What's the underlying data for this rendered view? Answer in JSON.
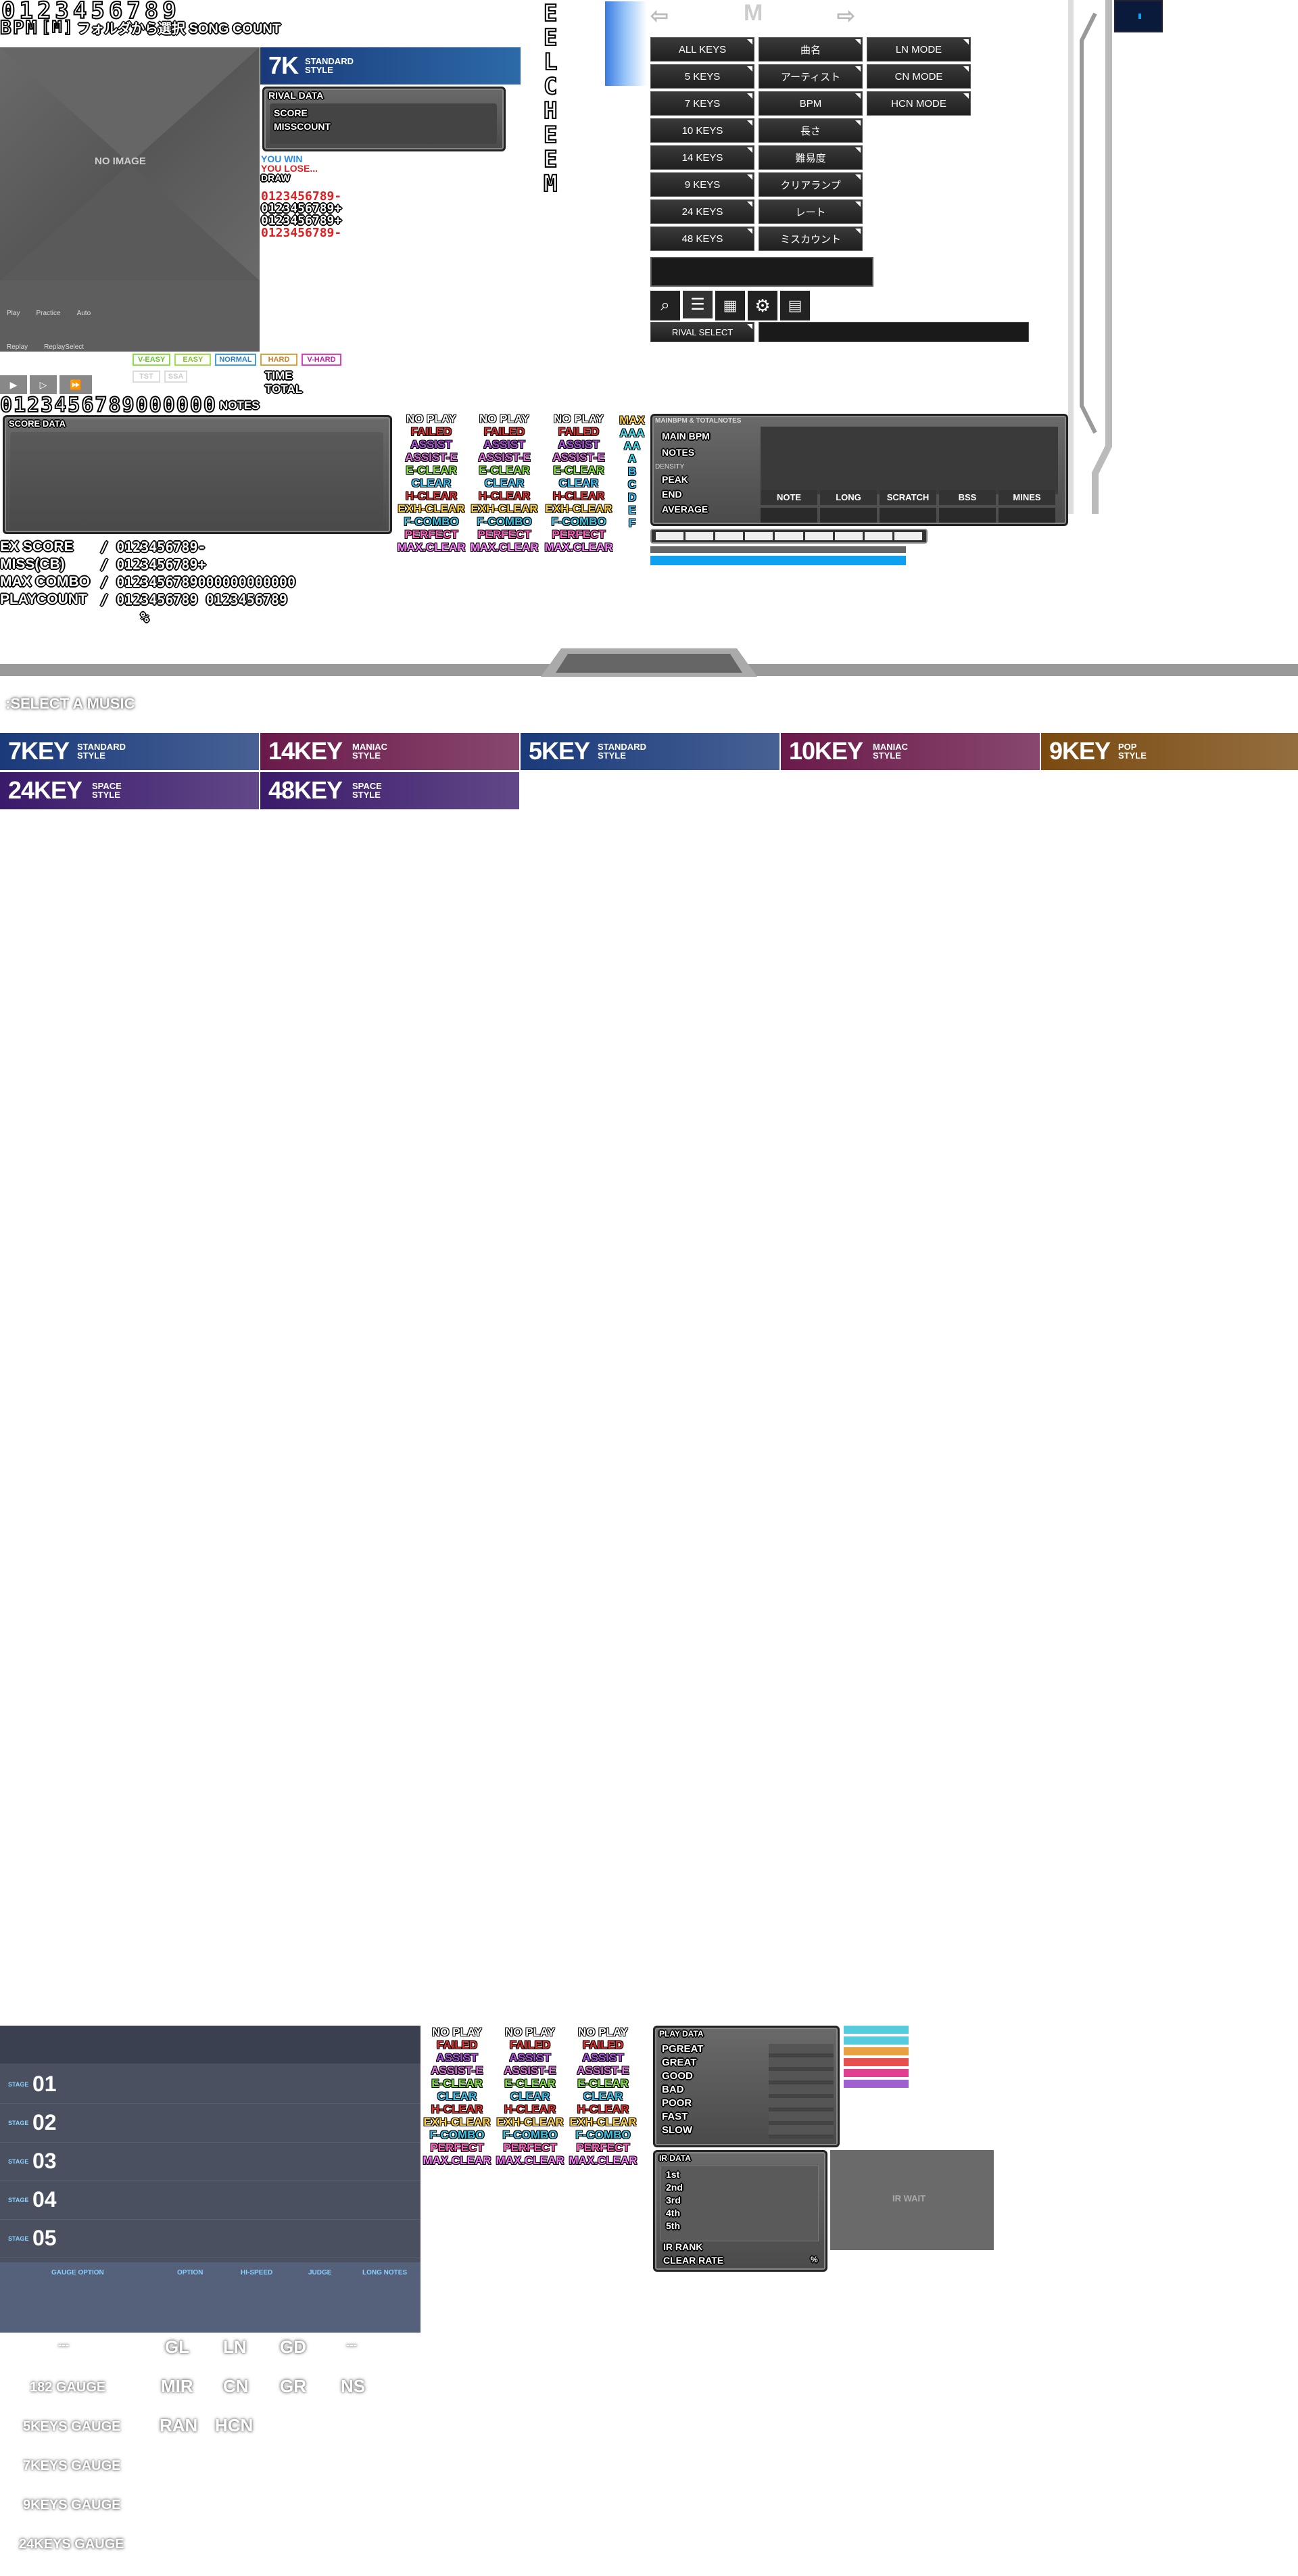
{
  "top": {
    "digits_row": "0123456789",
    "bpm_label": "BPM",
    "bpm_value": "[M]",
    "folder_line": "フォルダから選択 SONG COUNT"
  },
  "noimage": {
    "label": "NO IMAGE",
    "play": "Play",
    "practice": "Practice",
    "auto": "Auto",
    "replay": "Replay",
    "replay_select": "ReplaySelect"
  },
  "style_banner": {
    "big": "7K",
    "line1": "STANDARD",
    "line2": "STYLE"
  },
  "rival": {
    "title": "RIVAL DATA",
    "score": "SCORE",
    "misscount": "MISSCOUNT"
  },
  "result": {
    "win": "YOU WIN",
    "lose": "YOU LOSE...",
    "draw": "DRAW",
    "d1": "0123456789",
    "s1": "-",
    "d2": "0123456789",
    "s2": "+",
    "d3": "0123456789",
    "s3": "+",
    "d4": "0123456789",
    "s4": "-"
  },
  "difficulty": {
    "veasy": "V-EASY",
    "easy": "EASY",
    "normal": "NORMAL",
    "hard": "HARD",
    "vhard": "V-HARD",
    "tst": "TST",
    "ssa": "SSA"
  },
  "info_labels": {
    "time": "TIME",
    "total": "TOTAL",
    "notes": "NOTES"
  },
  "big_digits": "0123456789000000",
  "score_data_title": "SCORE DATA",
  "stats": {
    "ex_score": "EX SCORE",
    "miss": "MISS(CB)",
    "max_combo": "MAX COMBO",
    "playcount": "PLAYCOUNT",
    "v1": "0123456789",
    "v1s": "-",
    "v2": "0123456789",
    "v2s": "+",
    "v3": "0123456789",
    "v4": "000000000000",
    "v5a": "0123456789",
    "v5b": "0123456789",
    "pct": "%"
  },
  "lamps": [
    "NO PLAY",
    "FAILED",
    "ASSIST",
    "ASSIST-E",
    "E-CLEAR",
    "CLEAR",
    "H-CLEAR",
    "EXH-CLEAR",
    "F-COMBO",
    "PERFECT",
    "MAX.CLEAR"
  ],
  "ranks": [
    "MAX",
    "AAA",
    "AA",
    "A",
    "B",
    "C",
    "D",
    "E",
    "F"
  ],
  "vertical_chars": [
    "E",
    "E",
    "L",
    "C",
    "H",
    "E",
    "E",
    "M"
  ],
  "keys_menu": {
    "all": "ALL KEYS",
    "k5": "5 KEYS",
    "k7": "7 KEYS",
    "k10": "10 KEYS",
    "k14": "14 KEYS",
    "k9": "9 KEYS",
    "k24": "24 KEYS",
    "k48": "48 KEYS"
  },
  "sort_menu": {
    "title": "曲名",
    "artist": "アーティスト",
    "bpm": "BPM",
    "length": "長さ",
    "diff": "難易度",
    "clear": "クリアランプ",
    "rate": "レート",
    "miss": "ミスカウント"
  },
  "mode_menu": {
    "ln": "LN MODE",
    "cn": "CN MODE",
    "hcn": "HCN MODE"
  },
  "rival_select": "RIVAL SELECT",
  "chart_info": {
    "title": "MAINBPM & TOTALNOTES",
    "main_bpm": "MAIN BPM",
    "notes": "NOTES",
    "density": "DENSITY",
    "peak": "PEAK",
    "end": "END",
    "average": "AVERAGE",
    "note": "NOTE",
    "long": "LONG",
    "scratch": "SCRATCH",
    "bss": "BSS",
    "mines": "MINES"
  },
  "select_music": ":SELECT A MUSIC",
  "banners": [
    {
      "big": "7KEY",
      "l1": "STANDARD",
      "l2": "STYLE",
      "color": "#1a3a7a"
    },
    {
      "big": "14KEY",
      "l1": "MANIAC",
      "l2": "STYLE",
      "color": "#6a1a4a"
    },
    {
      "big": "5KEY",
      "l1": "STANDARD",
      "l2": "STYLE",
      "color": "#1a3a7a"
    },
    {
      "big": "10KEY",
      "l1": "MANIAC",
      "l2": "STYLE",
      "color": "#6a1a4a"
    },
    {
      "big": "9KEY",
      "l1": "POP",
      "l2": "STYLE",
      "color": "#7a4a10"
    },
    {
      "big": "24KEY",
      "l1": "SPACE",
      "l2": "STYLE",
      "color": "#3a1a6a"
    },
    {
      "big": "48KEY",
      "l1": "SPACE",
      "l2": "STYLE",
      "color": "#3a1a6a"
    }
  ],
  "stages": {
    "label": "STAGE",
    "s1": "01",
    "s2": "02",
    "s3": "03",
    "s4": "04",
    "s5": "05"
  },
  "option_bar": {
    "gauge": "GAUGE OPTION",
    "option": "OPTION",
    "hispeed": "HI-SPEED",
    "judge": "JUDGE",
    "long": "LONG NOTES"
  },
  "play_data": {
    "title": "PLAY DATA",
    "pgreat": "PGREAT",
    "great": "GREAT",
    "good": "GOOD",
    "bad": "BAD",
    "poor": "POOR",
    "fast": "FAST",
    "slow": "SLOW"
  },
  "ir_data": {
    "title": "IR DATA",
    "r1": "1st",
    "r2": "2nd",
    "r3": "3rd",
    "r4": "4th",
    "r5": "5th",
    "ir_rank": "IR RANK",
    "clear_rate": "CLEAR RATE",
    "pct": "%",
    "wait": "IR WAIT"
  },
  "gauges": {
    "g5": "5KEYS GAUGE",
    "g7": "7KEYS GAUGE",
    "g9": "9KEYS GAUGE",
    "g24": "24KEYS GAUGE",
    "g182": "182 GAUGE",
    "gl": "GL",
    "ln": "LN",
    "gd": "GD",
    "mir": "MIR",
    "cn": "CN",
    "gr": "GR",
    "ns": "NS",
    "ran": "RAN",
    "hcn": "HCN",
    "dash1": "---",
    "dash2": "---"
  },
  "colors": {
    "accent_blue": "#10a0f0",
    "play_bars": [
      "#55ccdd",
      "#e8a040",
      "#e85050",
      "#e04090",
      "#a060d0"
    ]
  }
}
